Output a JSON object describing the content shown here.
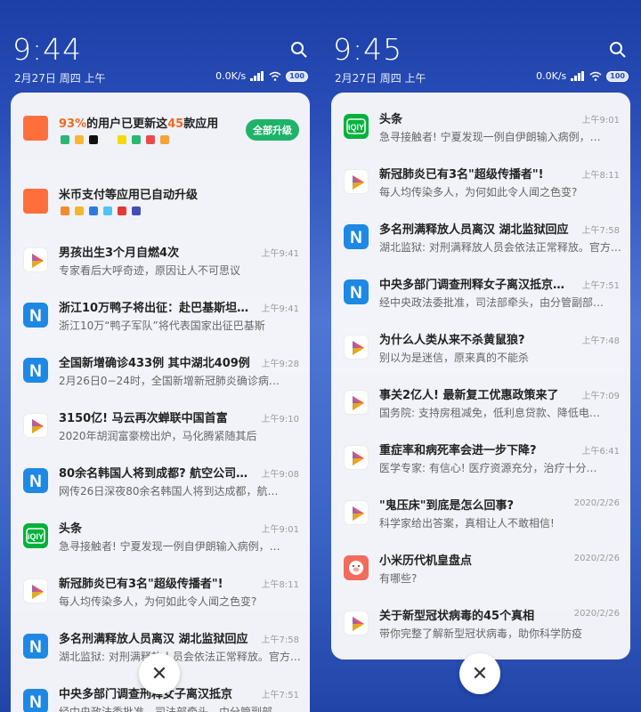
{
  "colors": {
    "highlight": "#f06a1e",
    "upgrade": "#1fb36a",
    "n_app": "#1e88e5",
    "iqiyi": "#00b23a"
  },
  "left": {
    "time": "9:44",
    "date": "2月27日 周四 上午",
    "speed": "0.0K/s",
    "battery": "100",
    "update": {
      "pct": "93%",
      "mid": "的用户已更新这",
      "count": "45",
      "end": "款应用",
      "button": "全部升级",
      "auto": "米币支付等应用已自动升级"
    },
    "items": [
      {
        "icon": "play",
        "title": "男孩出生3个月自燃4次",
        "time": "上午9:41",
        "text": "专家看后大呼奇迹，原因让人不可思议"
      },
      {
        "icon": "n",
        "title": "浙江10万鸭子将出征：赴巴基斯坦…",
        "time": "上午9:41",
        "text": "浙江10万“鸭子军队”将代表国家出征巴基斯"
      },
      {
        "icon": "n",
        "title": "全国新增确诊433例 其中湖北409例",
        "time": "上午9:28",
        "text": "2月26日0−24时，全国新增新冠肺炎确诊病…"
      },
      {
        "icon": "play",
        "title": "3150亿! 马云再次蝉联中国首富",
        "time": "上午9:10",
        "text": "2020年胡润富豪榜出炉，马化腾紧随其后"
      },
      {
        "icon": "n",
        "title": "80余名韩国人将到成都? 航空公司…",
        "time": "上午9:08",
        "text": "网传26日深夜80余名韩国人将到达成都，航…"
      },
      {
        "icon": "iqiyi",
        "title": "头条",
        "time": "上午9:01",
        "text": "急寻接触者! 宁夏发现一例自伊朗输入病例，…"
      },
      {
        "icon": "play",
        "title": "新冠肺炎已有3名\"超级传播者\"!",
        "time": "上午8:11",
        "text": "每人均传染多人，为何如此令人闻之色变?"
      },
      {
        "icon": "n",
        "title": "多名刑满释放人员离汉 湖北监狱回应",
        "time": "上午7:58",
        "text": "湖北监狱: 对刑满释放人员会依法正常释放。官方…"
      },
      {
        "icon": "n",
        "title": "中央多部门调查刑释女子离汉抵京",
        "time": "上午7:51",
        "text": "经中央政法委批准，司法部牵头，由分管副部"
      }
    ]
  },
  "right": {
    "time": "9:45",
    "date": "2月27日 周四 上午",
    "speed": "0.0K/s",
    "battery": "100",
    "items": [
      {
        "icon": "iqiyi",
        "title": "头条",
        "time": "上午9:01",
        "text": "急寻接触者! 宁夏发现一例自伊朗输入病例，…"
      },
      {
        "icon": "play",
        "title": "新冠肺炎已有3名\"超级传播者\"!",
        "time": "上午8:11",
        "text": "每人均传染多人，为何如此令人闻之色变?"
      },
      {
        "icon": "n",
        "title": "多名刑满释放人员离汉 湖北监狱回应",
        "time": "上午7:58",
        "text": "湖北监狱: 对刑满释放人员会依法正常释放。官方…"
      },
      {
        "icon": "n",
        "title": "中央多部门调查刑释女子离汉抵京…",
        "time": "上午7:51",
        "text": "经中央政法委批准，司法部牵头，由分管副部…"
      },
      {
        "icon": "play",
        "title": "为什么人类从来不杀黄鼠狼?",
        "time": "上午7:48",
        "text": "别以为是迷信，原来真的不能杀"
      },
      {
        "icon": "play",
        "title": "事关2亿人! 最新复工优惠政策来了",
        "time": "上午7:09",
        "text": "国务院: 支持房租减免，低利息贷款、降低电…"
      },
      {
        "icon": "play",
        "title": "重症率和病死率会进一步下降?",
        "time": "上午6:41",
        "text": "医学专家: 有信心! 医疗资源充分，治疗十分…"
      },
      {
        "icon": "play",
        "title": "\"鬼压床\"到底是怎么回事?",
        "time": "2020/2/26",
        "text": "科学家给出答案，真相让人不敢相信!"
      },
      {
        "icon": "pig",
        "title": "小米历代机皇盘点",
        "time": "2020/2/26",
        "text": "有哪些?"
      },
      {
        "icon": "play",
        "title": "关于新型冠状病毒的45个真相",
        "time": "2020/2/26",
        "text": "带你完整了解新型冠状病毒，助你科学防疫"
      }
    ]
  },
  "close_symbol": "✕"
}
